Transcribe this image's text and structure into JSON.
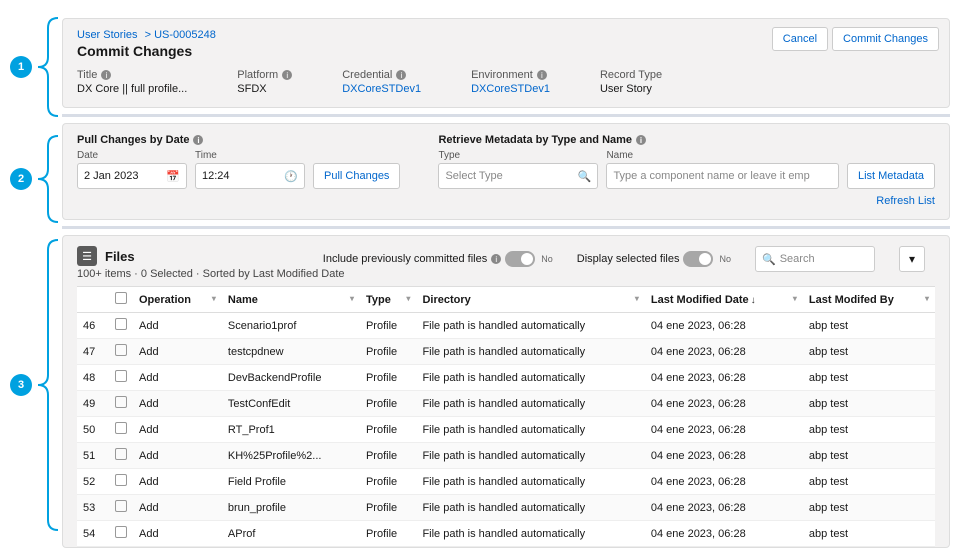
{
  "markers": {
    "one": "1",
    "two": "2",
    "three": "3"
  },
  "breadcrumb": {
    "root": "User Stories",
    "sep": ">",
    "id": "US-0005248"
  },
  "page_title": "Commit Changes",
  "buttons": {
    "cancel": "Cancel",
    "commit": "Commit Changes"
  },
  "header": {
    "title_lbl": "Title",
    "title_val": "DX Core || full profile...",
    "platform_lbl": "Platform",
    "platform_val": "SFDX",
    "cred_lbl": "Credential",
    "cred_val": "DXCoreSTDev1",
    "env_lbl": "Environment",
    "env_val": "DXCoreSTDev1",
    "rec_lbl": "Record Type",
    "rec_val": "User Story"
  },
  "pull": {
    "title": "Pull Changes by Date",
    "date_lbl": "Date",
    "date_val": "2 Jan 2023",
    "time_lbl": "Time",
    "time_val": "12:24",
    "btn": "Pull Changes"
  },
  "retrieve": {
    "title": "Retrieve Metadata by Type and Name",
    "type_lbl": "Type",
    "type_ph": "Select Type",
    "name_lbl": "Name",
    "name_ph": "Type a component name or leave it emp",
    "list_btn": "List Metadata",
    "refresh": "Refresh List"
  },
  "files": {
    "title": "Files",
    "summary": "100+ items · 0 Selected · Sorted by Last Modified Date",
    "include_lbl": "Include previously committed files",
    "display_lbl": "Display selected files",
    "toggle_no": "No",
    "search_ph": "Search",
    "cols": {
      "op": "Operation",
      "name": "Name",
      "type": "Type",
      "dir": "Directory",
      "lmd": "Last Modified Date",
      "lmb": "Last Modifed By"
    },
    "rows": [
      {
        "n": "46",
        "op": "Add",
        "name": "Scenario1prof",
        "type": "Profile",
        "dir": "File path is handled automatically",
        "lmd": "04 ene 2023, 06:28",
        "lmb": "abp test"
      },
      {
        "n": "47",
        "op": "Add",
        "name": "testcpdnew",
        "type": "Profile",
        "dir": "File path is handled automatically",
        "lmd": "04 ene 2023, 06:28",
        "lmb": "abp test"
      },
      {
        "n": "48",
        "op": "Add",
        "name": "DevBackendProfile",
        "type": "Profile",
        "dir": "File path is handled automatically",
        "lmd": "04 ene 2023, 06:28",
        "lmb": "abp test"
      },
      {
        "n": "49",
        "op": "Add",
        "name": "TestConfEdit",
        "type": "Profile",
        "dir": "File path is handled automatically",
        "lmd": "04 ene 2023, 06:28",
        "lmb": "abp test"
      },
      {
        "n": "50",
        "op": "Add",
        "name": "RT_Prof1",
        "type": "Profile",
        "dir": "File path is handled automatically",
        "lmd": "04 ene 2023, 06:28",
        "lmb": "abp test"
      },
      {
        "n": "51",
        "op": "Add",
        "name": "KH%25Profile%2...",
        "type": "Profile",
        "dir": "File path is handled automatically",
        "lmd": "04 ene 2023, 06:28",
        "lmb": "abp test"
      },
      {
        "n": "52",
        "op": "Add",
        "name": "Field Profile",
        "type": "Profile",
        "dir": "File path is handled automatically",
        "lmd": "04 ene 2023, 06:28",
        "lmb": "abp test"
      },
      {
        "n": "53",
        "op": "Add",
        "name": "brun_profile",
        "type": "Profile",
        "dir": "File path is handled automatically",
        "lmd": "04 ene 2023, 06:28",
        "lmb": "abp test"
      },
      {
        "n": "54",
        "op": "Add",
        "name": "AProf",
        "type": "Profile",
        "dir": "File path is handled automatically",
        "lmd": "04 ene 2023, 06:28",
        "lmb": "abp test"
      }
    ]
  }
}
